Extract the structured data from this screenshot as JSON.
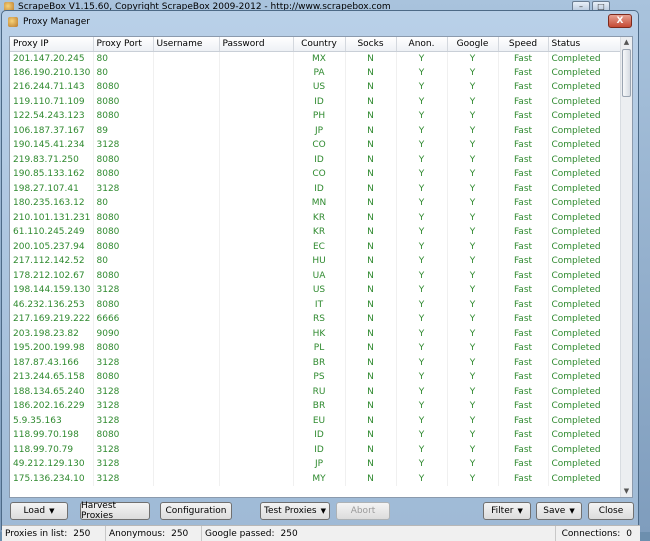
{
  "app": {
    "title": "ScrapeBox V1.15.60, Copyright ScrapeBox 2009-2012 - http://www.scrapebox.com"
  },
  "dialog": {
    "title": "Proxy Manager",
    "close_label": "X"
  },
  "columns": [
    "Proxy IP",
    "Proxy Port",
    "Username",
    "Password",
    "Country",
    "Socks",
    "Anon.",
    "Google",
    "Speed",
    "Status"
  ],
  "rows": [
    [
      "201.147.20.245",
      "80",
      "",
      "",
      "MX",
      "N",
      "Y",
      "Y",
      "Fast",
      "Completed"
    ],
    [
      "186.190.210.130",
      "80",
      "",
      "",
      "PA",
      "N",
      "Y",
      "Y",
      "Fast",
      "Completed"
    ],
    [
      "216.244.71.143",
      "8080",
      "",
      "",
      "US",
      "N",
      "Y",
      "Y",
      "Fast",
      "Completed"
    ],
    [
      "119.110.71.109",
      "8080",
      "",
      "",
      "ID",
      "N",
      "Y",
      "Y",
      "Fast",
      "Completed"
    ],
    [
      "122.54.243.123",
      "8080",
      "",
      "",
      "PH",
      "N",
      "Y",
      "Y",
      "Fast",
      "Completed"
    ],
    [
      "106.187.37.167",
      "89",
      "",
      "",
      "JP",
      "N",
      "Y",
      "Y",
      "Fast",
      "Completed"
    ],
    [
      "190.145.41.234",
      "3128",
      "",
      "",
      "CO",
      "N",
      "Y",
      "Y",
      "Fast",
      "Completed"
    ],
    [
      "219.83.71.250",
      "8080",
      "",
      "",
      "ID",
      "N",
      "Y",
      "Y",
      "Fast",
      "Completed"
    ],
    [
      "190.85.133.162",
      "8080",
      "",
      "",
      "CO",
      "N",
      "Y",
      "Y",
      "Fast",
      "Completed"
    ],
    [
      "198.27.107.41",
      "3128",
      "",
      "",
      "ID",
      "N",
      "Y",
      "Y",
      "Fast",
      "Completed"
    ],
    [
      "180.235.163.12",
      "80",
      "",
      "",
      "MN",
      "N",
      "Y",
      "Y",
      "Fast",
      "Completed"
    ],
    [
      "210.101.131.231",
      "8080",
      "",
      "",
      "KR",
      "N",
      "Y",
      "Y",
      "Fast",
      "Completed"
    ],
    [
      "61.110.245.249",
      "8080",
      "",
      "",
      "KR",
      "N",
      "Y",
      "Y",
      "Fast",
      "Completed"
    ],
    [
      "200.105.237.94",
      "8080",
      "",
      "",
      "EC",
      "N",
      "Y",
      "Y",
      "Fast",
      "Completed"
    ],
    [
      "217.112.142.52",
      "80",
      "",
      "",
      "HU",
      "N",
      "Y",
      "Y",
      "Fast",
      "Completed"
    ],
    [
      "178.212.102.67",
      "8080",
      "",
      "",
      "UA",
      "N",
      "Y",
      "Y",
      "Fast",
      "Completed"
    ],
    [
      "198.144.159.130",
      "3128",
      "",
      "",
      "US",
      "N",
      "Y",
      "Y",
      "Fast",
      "Completed"
    ],
    [
      "46.232.136.253",
      "8080",
      "",
      "",
      "IT",
      "N",
      "Y",
      "Y",
      "Fast",
      "Completed"
    ],
    [
      "217.169.219.222",
      "6666",
      "",
      "",
      "RS",
      "N",
      "Y",
      "Y",
      "Fast",
      "Completed"
    ],
    [
      "203.198.23.82",
      "9090",
      "",
      "",
      "HK",
      "N",
      "Y",
      "Y",
      "Fast",
      "Completed"
    ],
    [
      "195.200.199.98",
      "8080",
      "",
      "",
      "PL",
      "N",
      "Y",
      "Y",
      "Fast",
      "Completed"
    ],
    [
      "187.87.43.166",
      "3128",
      "",
      "",
      "BR",
      "N",
      "Y",
      "Y",
      "Fast",
      "Completed"
    ],
    [
      "213.244.65.158",
      "8080",
      "",
      "",
      "PS",
      "N",
      "Y",
      "Y",
      "Fast",
      "Completed"
    ],
    [
      "188.134.65.240",
      "3128",
      "",
      "",
      "RU",
      "N",
      "Y",
      "Y",
      "Fast",
      "Completed"
    ],
    [
      "186.202.16.229",
      "3128",
      "",
      "",
      "BR",
      "N",
      "Y",
      "Y",
      "Fast",
      "Completed"
    ],
    [
      "5.9.35.163",
      "3128",
      "",
      "",
      "EU",
      "N",
      "Y",
      "Y",
      "Fast",
      "Completed"
    ],
    [
      "118.99.70.198",
      "8080",
      "",
      "",
      "ID",
      "N",
      "Y",
      "Y",
      "Fast",
      "Completed"
    ],
    [
      "118.99.70.79",
      "3128",
      "",
      "",
      "ID",
      "N",
      "Y",
      "Y",
      "Fast",
      "Completed"
    ],
    [
      "49.212.129.130",
      "3128",
      "",
      "",
      "JP",
      "N",
      "Y",
      "Y",
      "Fast",
      "Completed"
    ],
    [
      "175.136.234.10",
      "3128",
      "",
      "",
      "MY",
      "N",
      "Y",
      "Y",
      "Fast",
      "Completed"
    ]
  ],
  "buttons": {
    "load": "Load",
    "harvest": "Harvest Proxies",
    "configuration": "Configuration",
    "test": "Test Proxies",
    "abort": "Abort",
    "filter": "Filter",
    "save": "Save",
    "close": "Close"
  },
  "status": {
    "in_list_label": "Proxies in list:",
    "in_list_value": "250",
    "anonymous_label": "Anonymous:",
    "anonymous_value": "250",
    "google_label": "Google passed:",
    "google_value": "250",
    "connections_label": "Connections:",
    "connections_value": "0"
  },
  "colors": {
    "row_text": "#2f8a2f",
    "dialog_bg": "#b9d0e8",
    "close_button": "#c54a34"
  }
}
